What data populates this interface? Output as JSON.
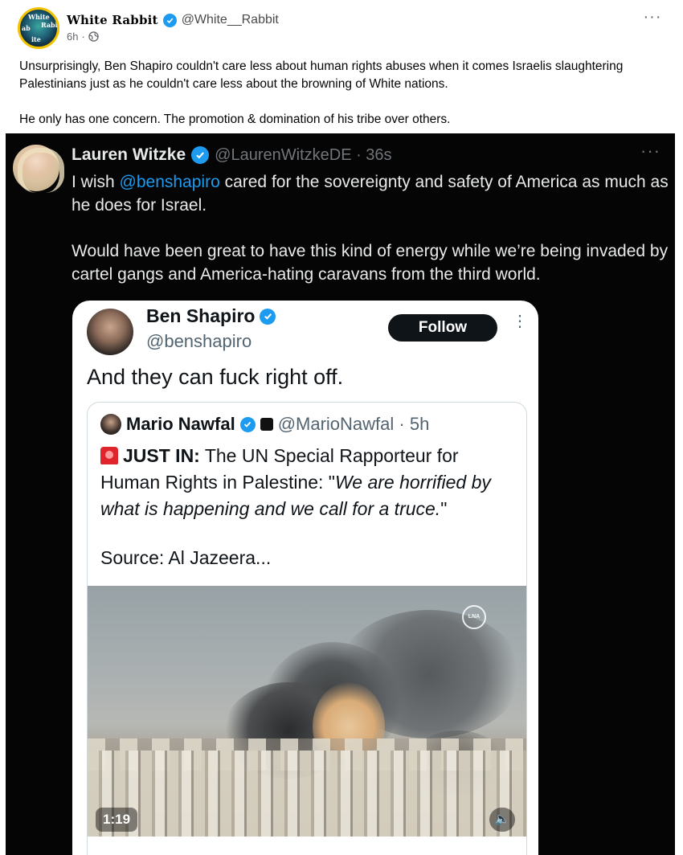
{
  "post": {
    "author_name": "White Rabbit",
    "author_handle": "@White__Rabbit",
    "timestamp": "6h",
    "separator": "·",
    "more_label": "···",
    "body": [
      "Unsurprisingly, Ben Shapiro couldn't care less about human rights abuses when it comes Israelis slaughtering Palestinians just as he couldn't care less about the browning of White nations.",
      "He only has one concern. The promotion & domination of his tribe over others."
    ]
  },
  "embedded_tweet": {
    "author_name": "Lauren Witzke",
    "author_handle": "@LaurenWitzkeDE · 36s",
    "more_label": "···",
    "line1_pre": "I wish ",
    "line1_mention": "@benshapiro",
    "line1_post": " cared for the sovereignty and safety of America as much as he does for Israel.",
    "line2": "Would have been great to have this kind of energy while we’re being invaded by cartel gangs and America-hating caravans from the third world."
  },
  "inner_tweet": {
    "author_name": "Ben Shapiro",
    "author_handle": "@benshapiro",
    "follow_label": "Follow",
    "more_label": "⋮",
    "text": "And they can fuck right off."
  },
  "quoted_tweet": {
    "author_name": "Mario Nawfal",
    "author_handle": "@MarioNawfal · 5h",
    "text_bold": "JUST IN:",
    "text_plain": " The UN Special Rapporteur for Human Rights in Palestine: \"",
    "text_italic": "We are horrified by what is happening and we call for a truce.",
    "text_end": "\"",
    "source": "Source: Al Jazeera...",
    "video_logo": "LNA",
    "video_duration": "1:19"
  },
  "colors": {
    "verified": "#1d9bf0",
    "link": "#1d9bf0",
    "dark_bg": "#050505"
  }
}
